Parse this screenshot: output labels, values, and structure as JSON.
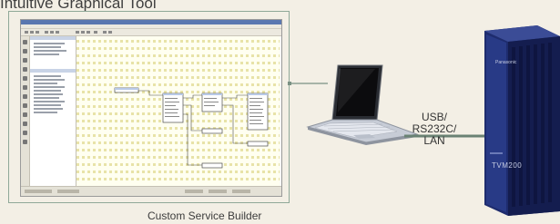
{
  "heading": "Intuitive Graphical Tool",
  "software_caption": "Custom Service Builder",
  "connection_label_lines": [
    "USB/",
    "RS232C/",
    "LAN"
  ],
  "pbx_brand": "Panasonic",
  "pbx_model": "TVM200",
  "colors": {
    "background": "#f3efe5",
    "frame_border": "#8fa898",
    "cable": "#6a8273",
    "pbx_body": "#1e2c6e"
  },
  "icons": [
    "laptop-icon",
    "voicemail-server-icon"
  ]
}
